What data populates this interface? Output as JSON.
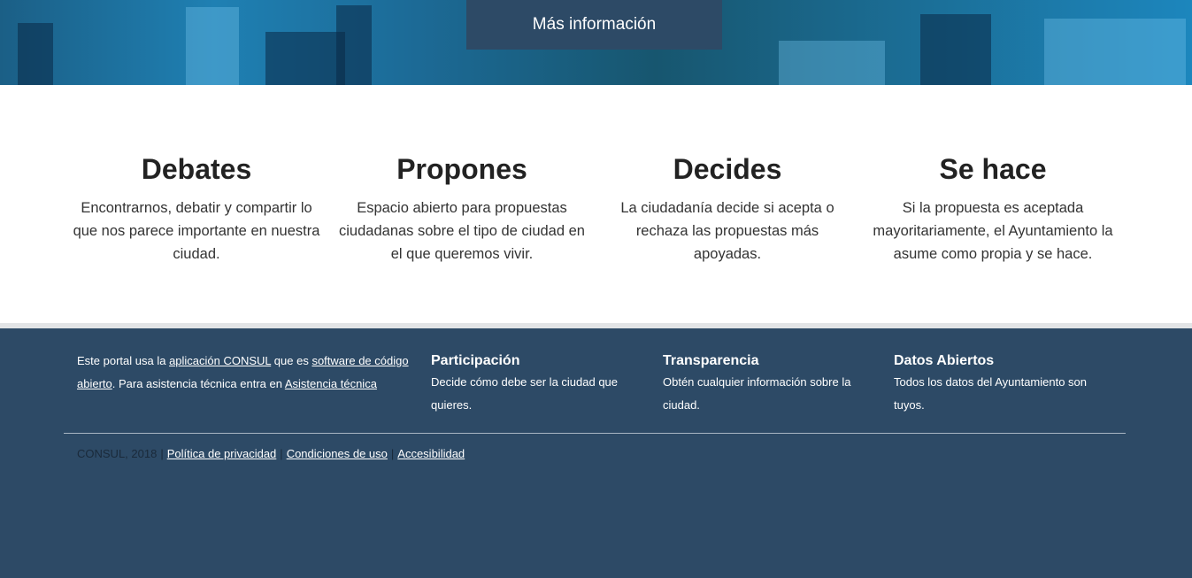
{
  "hero": {
    "button_label": "Más información"
  },
  "steps": [
    {
      "title": "Debates",
      "text": "Encontrarnos, debatir y compartir lo que nos parece importante en nuestra ciudad."
    },
    {
      "title": "Propones",
      "text": "Espacio abierto para propuestas ciudadanas sobre el tipo de ciudad en el que queremos vivir."
    },
    {
      "title": "Decides",
      "text": "La ciudadanía decide si acepta o rechaza las propuestas más apoyadas."
    },
    {
      "title": "Se hace",
      "text": "Si la propuesta es aceptada mayoritariamente, el Ayuntamiento la asume como propia y se hace."
    }
  ],
  "footer": {
    "about": {
      "prefix": "Este portal usa la ",
      "link1": "aplicación CONSUL",
      "middle": " que es ",
      "link2": "software de código abierto",
      "suffix": ". Para asistencia técnica entra en ",
      "link3": "Asistencia técnica"
    },
    "columns": [
      {
        "title": "Participación",
        "text": "Decide cómo debe ser la ciudad que quieres."
      },
      {
        "title": "Transparencia",
        "text": "Obtén cualquier información sobre la ciudad."
      },
      {
        "title": "Datos Abiertos",
        "text": "Todos los datos del Ayuntamiento son tuyos."
      }
    ],
    "copyright": "CONSUL, 2018",
    "separator": "|",
    "links": [
      "Política de privacidad",
      "Condiciones de uso",
      "Accesibilidad"
    ]
  },
  "colors": {
    "footer_bg": "#2d4a66",
    "hero_button_bg": "#2d4a66",
    "divider": "#e2e4e6"
  }
}
